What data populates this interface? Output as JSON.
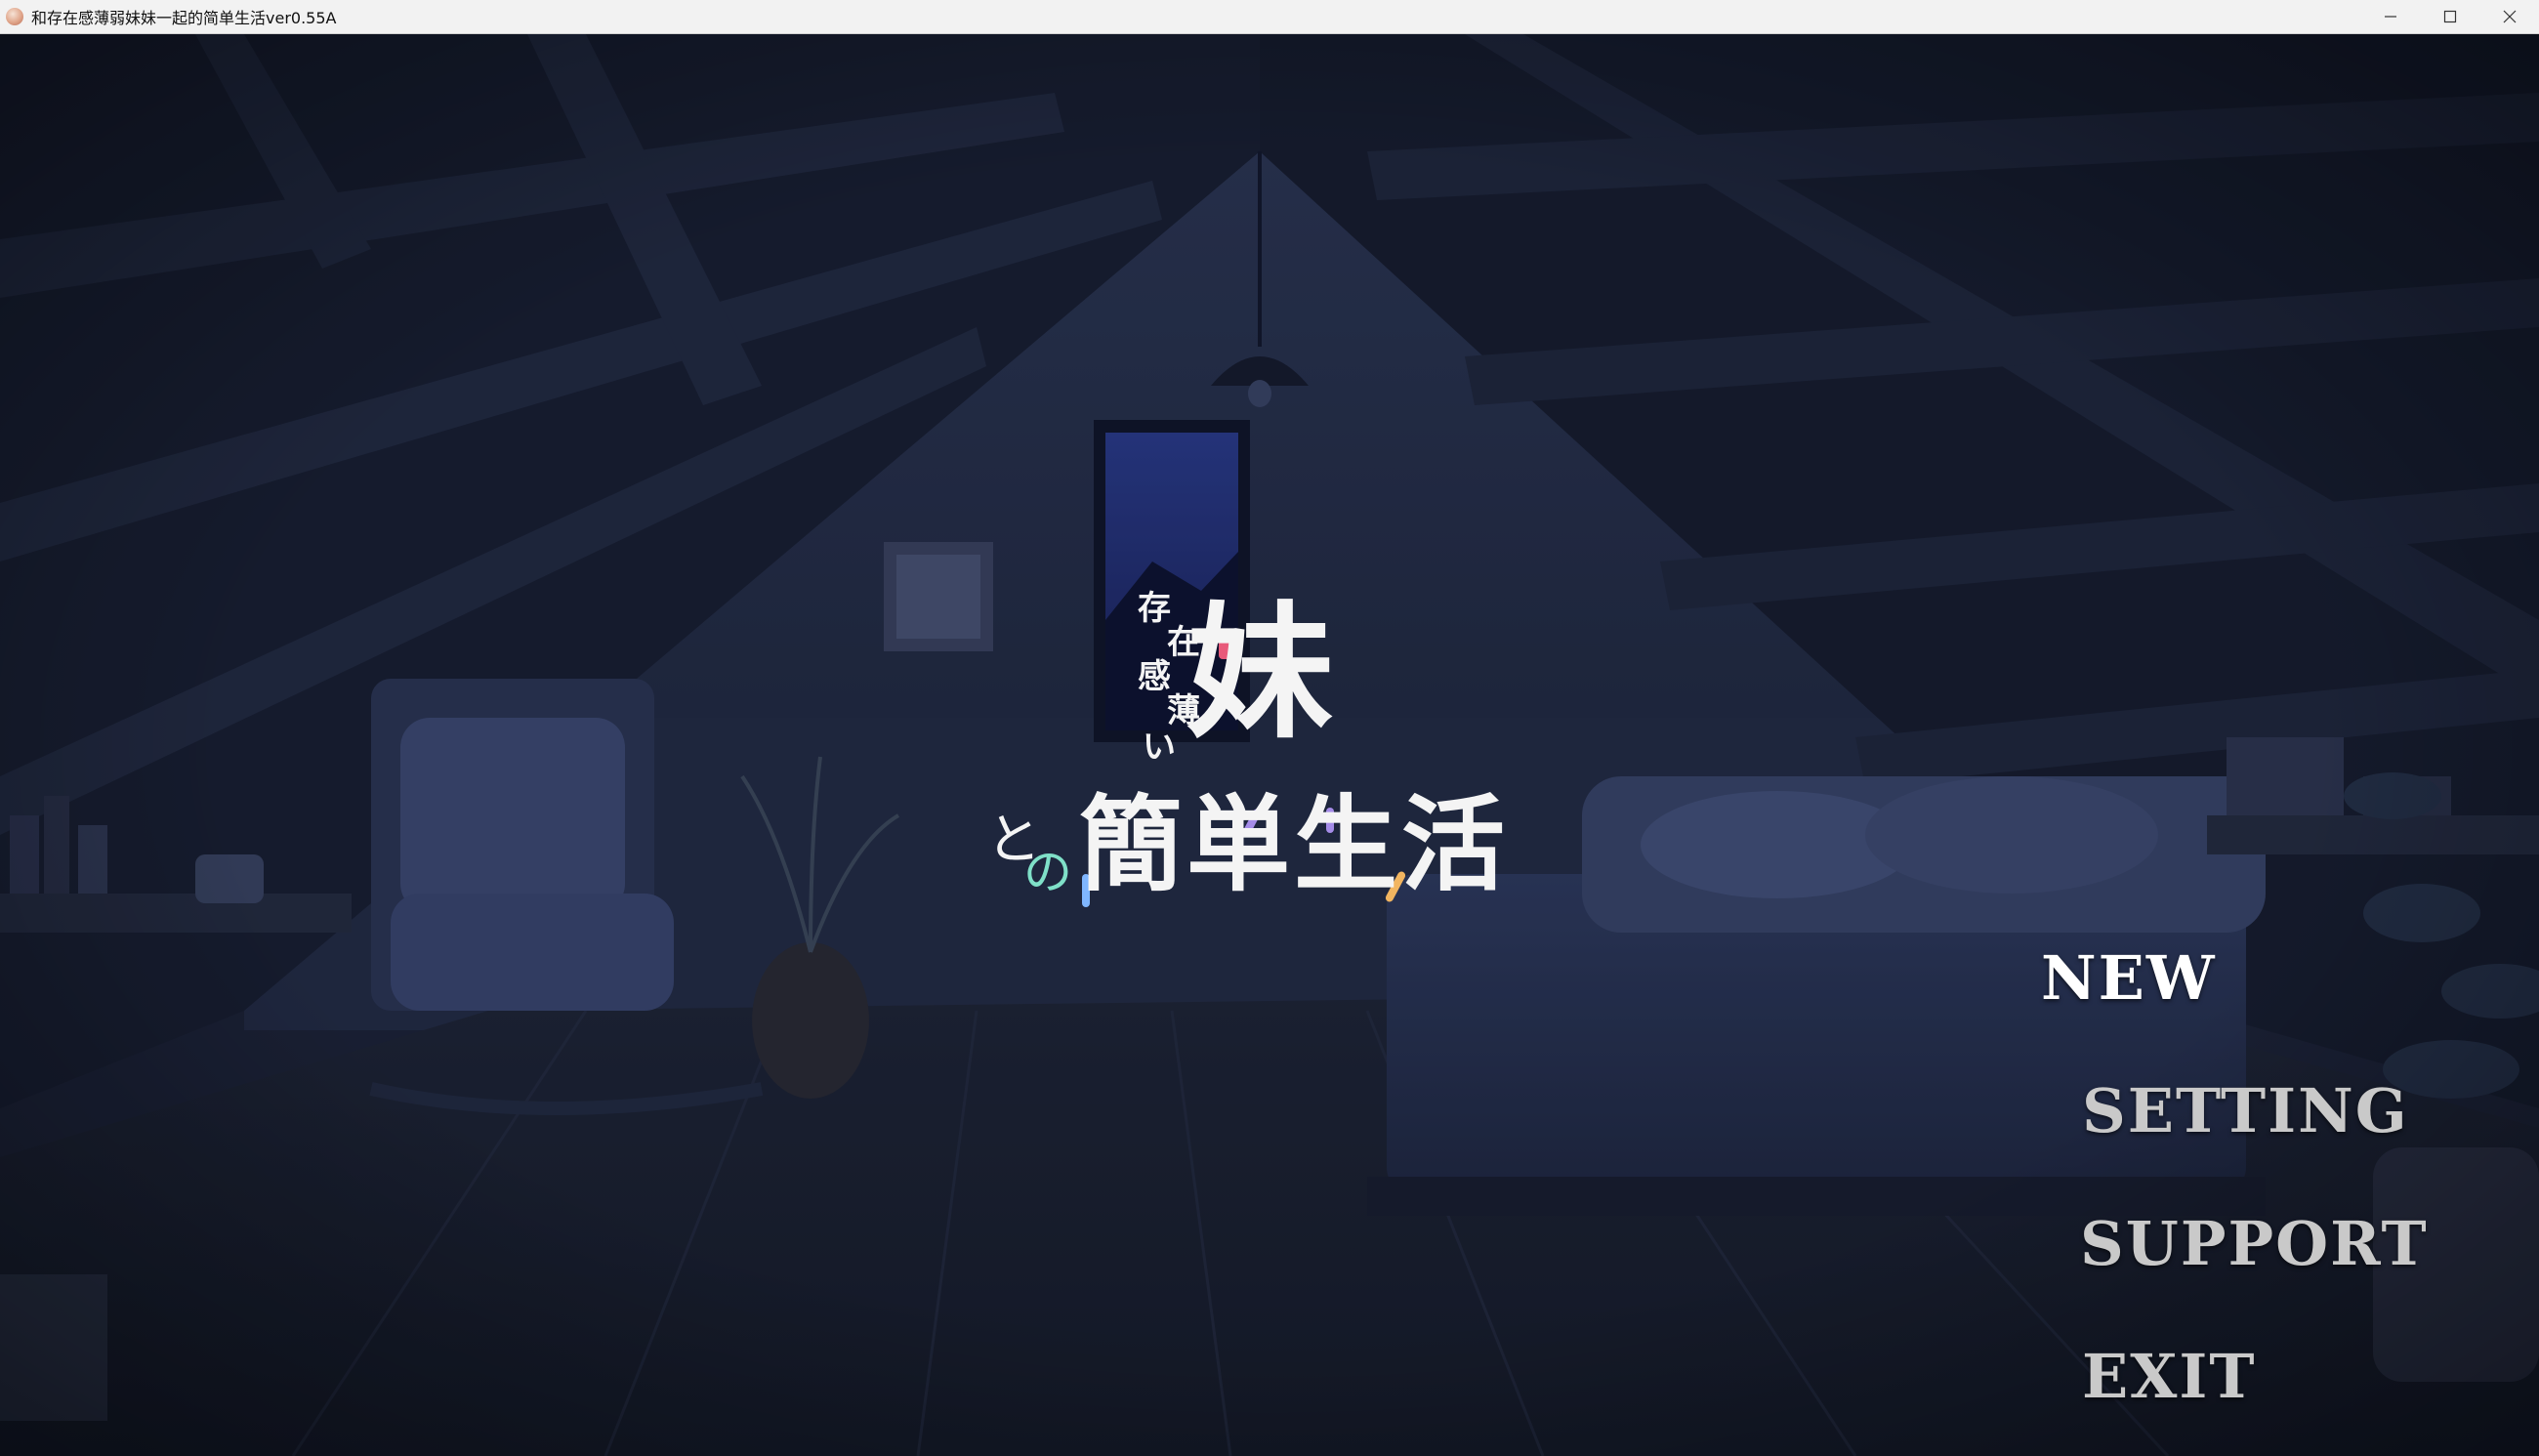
{
  "window": {
    "title": "和存在感薄弱妹妹一起的简单生活ver0.55A"
  },
  "logo": {
    "vertical_chars": [
      "存",
      "在",
      "感",
      "薄",
      "い"
    ],
    "big_char": "妹",
    "to": "と",
    "no": "の",
    "main": "簡単生活"
  },
  "menu": {
    "items": [
      {
        "label": "NEW",
        "state": "selected"
      },
      {
        "label": "SETTING",
        "state": "normal"
      },
      {
        "label": "SUPPORT",
        "state": "normal"
      },
      {
        "label": "EXIT",
        "state": "normal"
      }
    ]
  },
  "colors": {
    "menu_selected": "#ffffff",
    "menu_normal": "#c9c9c9",
    "accent_pink": "#e85a7a",
    "accent_teal": "#7fe0c8",
    "accent_purple": "#a58ce8",
    "accent_blue": "#7fb6ff",
    "accent_orange": "#f2b560"
  },
  "icons": {
    "app": "game-app-icon",
    "minimize": "minimize-icon",
    "maximize": "maximize-icon",
    "close": "close-icon"
  }
}
